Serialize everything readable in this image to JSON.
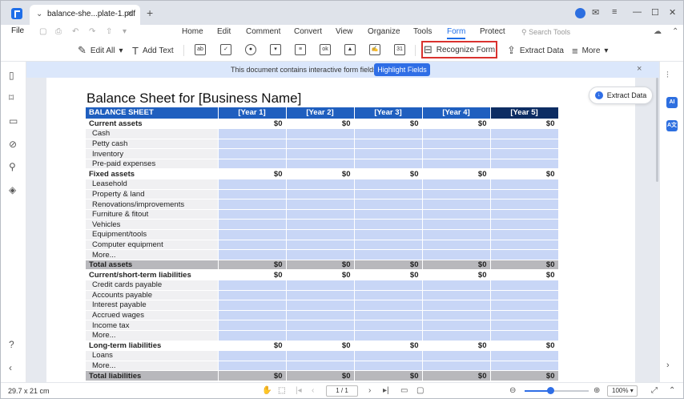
{
  "tab": {
    "title": "balance-she...plate-1.pdf",
    "close": "×",
    "new": "+"
  },
  "menu": {
    "file": "File",
    "items": [
      "Home",
      "Edit",
      "Comment",
      "Convert",
      "View",
      "Organize",
      "Tools",
      "Form",
      "Protect"
    ],
    "active": "Form",
    "search_placeholder": "Search Tools"
  },
  "toolbar": {
    "edit_all": "Edit All",
    "add_text": "Add Text",
    "recognize_form": "Recognize Form",
    "extract_data": "Extract Data",
    "more": "More"
  },
  "notice": {
    "text": "This document contains interactive form fields.",
    "button": "Highlight Fields",
    "close": "×"
  },
  "extract_float": {
    "label": "Extract Data"
  },
  "doc": {
    "title": "Balance Sheet for [Business Name]",
    "header": {
      "label": "BALANCE SHEET",
      "years": [
        "[Year 1]",
        "[Year 2]",
        "[Year 3]",
        "[Year 4]",
        "[Year 5]"
      ]
    },
    "rows": [
      {
        "kind": "sec",
        "label": "Current assets",
        "values": [
          "$0",
          "$0",
          "$0",
          "$0",
          "$0"
        ]
      },
      {
        "kind": "item",
        "label": "Cash"
      },
      {
        "kind": "item",
        "label": "Petty cash"
      },
      {
        "kind": "item",
        "label": "Inventory"
      },
      {
        "kind": "item",
        "label": "Pre-paid expenses"
      },
      {
        "kind": "sec",
        "label": "Fixed assets",
        "values": [
          "$0",
          "$0",
          "$0",
          "$0",
          "$0"
        ]
      },
      {
        "kind": "item",
        "label": "Leasehold"
      },
      {
        "kind": "item",
        "label": "Property & land"
      },
      {
        "kind": "item",
        "label": "Renovations/improvements"
      },
      {
        "kind": "item",
        "label": "Furniture & fitout"
      },
      {
        "kind": "item",
        "label": "Vehicles"
      },
      {
        "kind": "item",
        "label": "Equipment/tools"
      },
      {
        "kind": "item",
        "label": "Computer equipment"
      },
      {
        "kind": "item",
        "label": "More..."
      },
      {
        "kind": "total",
        "label": "Total assets",
        "values": [
          "$0",
          "$0",
          "$0",
          "$0",
          "$0"
        ]
      },
      {
        "kind": "sec",
        "label": "Current/short-term liabilities",
        "values": [
          "$0",
          "$0",
          "$0",
          "$0",
          "$0"
        ]
      },
      {
        "kind": "item",
        "label": "Credit cards payable"
      },
      {
        "kind": "item",
        "label": "Accounts payable"
      },
      {
        "kind": "item",
        "label": "Interest payable"
      },
      {
        "kind": "item",
        "label": "Accrued wages"
      },
      {
        "kind": "item",
        "label": "Income tax"
      },
      {
        "kind": "item",
        "label": "More..."
      },
      {
        "kind": "sec",
        "label": "Long-term liabilities",
        "values": [
          "$0",
          "$0",
          "$0",
          "$0",
          "$0"
        ]
      },
      {
        "kind": "item",
        "label": "Loans"
      },
      {
        "kind": "item",
        "label": "More..."
      },
      {
        "kind": "total",
        "label": "Total liabilities",
        "values": [
          "$0",
          "$0",
          "$0",
          "$0",
          "$0"
        ]
      }
    ]
  },
  "status": {
    "page_size": "29.7 x 21 cm",
    "page_indicator": "1 / 1",
    "zoom": "100%",
    "zoom_level": 0.4
  },
  "colors": {
    "accent": "#1e6ee8",
    "header_blue": "#1f5fbf",
    "header_dark": "#0d2d63",
    "field_blue": "#c8d6f6",
    "highlight_red": "#d9322f"
  }
}
